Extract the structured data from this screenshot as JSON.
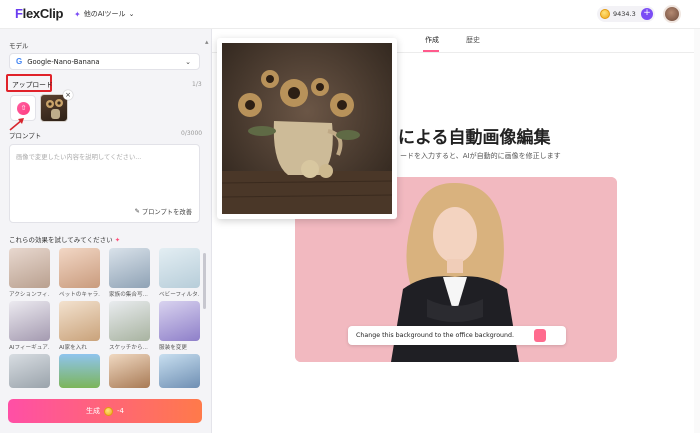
{
  "header": {
    "logo_f": "F",
    "logo_rest": "lexClip",
    "tools_label": "他のAIツール",
    "credits": "9434.3"
  },
  "sidebar": {
    "model_label": "モデル",
    "model_value": "Google-Nano-Banana",
    "upload_label": "アップロード",
    "upload_count": "1/3",
    "prompt_label": "プロンプト",
    "prompt_count": "0/3000",
    "prompt_placeholder": "画像で変更したい内容を説明してください...",
    "prompt_optimize": "プロンプトを改善",
    "effects_title": "これらの効果を試してみてください",
    "effects": [
      {
        "label": "アクションフィ..."
      },
      {
        "label": "ペットのキャラ..."
      },
      {
        "label": "家族の集合写..."
      },
      {
        "label": "ベビーフィルタ..."
      },
      {
        "label": "AIフィーギュア..."
      },
      {
        "label": "AI家を入れ"
      },
      {
        "label": "スケッチから..."
      },
      {
        "label": "服装を変更"
      },
      {
        "label": ""
      },
      {
        "label": ""
      },
      {
        "label": ""
      },
      {
        "label": ""
      }
    ],
    "generate_label": "生成",
    "generate_cost": "-4"
  },
  "main": {
    "tabs": [
      {
        "label": "作成"
      },
      {
        "label": "歴史"
      }
    ],
    "title": "による自動画像編集",
    "subtitle": "ードを入力すると、AIが自動的に画像を修正します",
    "demo_prompt": "Change this background to the office background."
  },
  "colors": {
    "accent": "#ff5a8c",
    "brand_purple": "#7b4df5",
    "highlight_red": "#e0222a"
  }
}
